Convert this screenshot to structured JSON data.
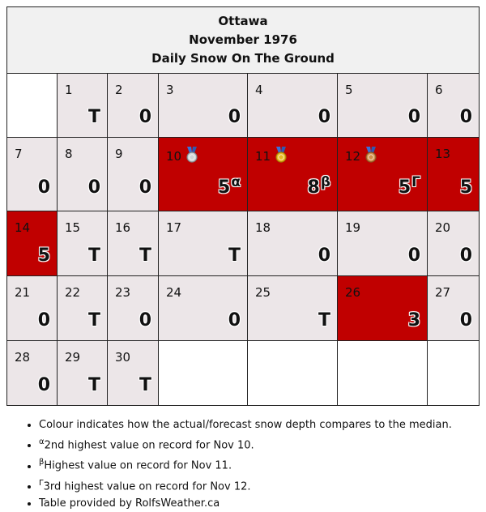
{
  "header": {
    "city": "Ottawa",
    "period": "November 1976",
    "subtitle": "Daily Snow On The Ground"
  },
  "colors": {
    "record_red": "#c00000",
    "normal_cell": "#ece6e8"
  },
  "weeks": [
    [
      null,
      {
        "day": "1",
        "value": "T"
      },
      {
        "day": "2",
        "value": "0"
      },
      {
        "day": "3",
        "value": "0"
      },
      {
        "day": "4",
        "value": "0"
      },
      {
        "day": "5",
        "value": "0"
      },
      {
        "day": "6",
        "value": "0"
      }
    ],
    [
      {
        "day": "7",
        "value": "0"
      },
      {
        "day": "8",
        "value": "0"
      },
      {
        "day": "9",
        "value": "0"
      },
      {
        "day": "10",
        "value": "5",
        "sup": "α",
        "medal": "silver-medal-icon",
        "color": "red"
      },
      {
        "day": "11",
        "value": "8",
        "sup": "β",
        "medal": "gold-medal-icon",
        "color": "red"
      },
      {
        "day": "12",
        "value": "5",
        "sup": "Γ",
        "medal": "bronze-medal-icon",
        "color": "red"
      },
      {
        "day": "13",
        "value": "5",
        "color": "red"
      }
    ],
    [
      {
        "day": "14",
        "value": "5",
        "color": "red"
      },
      {
        "day": "15",
        "value": "T"
      },
      {
        "day": "16",
        "value": "T"
      },
      {
        "day": "17",
        "value": "T"
      },
      {
        "day": "18",
        "value": "0"
      },
      {
        "day": "19",
        "value": "0"
      },
      {
        "day": "20",
        "value": "0"
      }
    ],
    [
      {
        "day": "21",
        "value": "0"
      },
      {
        "day": "22",
        "value": "T"
      },
      {
        "day": "23",
        "value": "0"
      },
      {
        "day": "24",
        "value": "0"
      },
      {
        "day": "25",
        "value": "T"
      },
      {
        "day": "26",
        "value": "3",
        "color": "red"
      },
      {
        "day": "27",
        "value": "0"
      }
    ],
    [
      {
        "day": "28",
        "value": "0"
      },
      {
        "day": "29",
        "value": "T"
      },
      {
        "day": "30",
        "value": "T"
      },
      null,
      null,
      null,
      null
    ]
  ],
  "notes": {
    "colour": "Colour indicates how the actual/forecast snow depth compares to the median.",
    "alpha_sym": "α",
    "alpha": "2nd highest value on record for Nov 10.",
    "beta_sym": "β",
    "beta": "Highest value on record for Nov 11.",
    "gamma_sym": "Γ",
    "gamma": "3rd highest value on record for Nov 12.",
    "credit": "Table provided by RolfsWeather.ca"
  }
}
